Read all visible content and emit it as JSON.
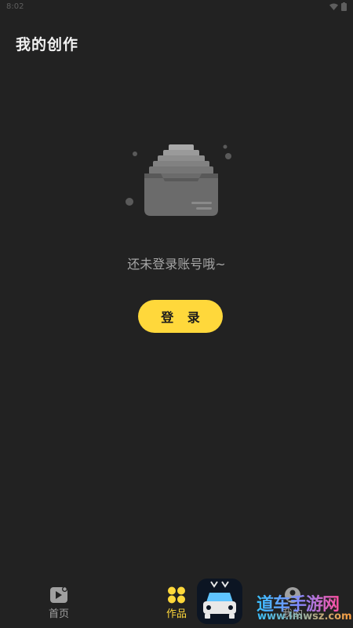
{
  "status_bar": {
    "time": "8:02"
  },
  "header": {
    "title": "我的创作"
  },
  "empty_state": {
    "icon": "empty-inbox-icon",
    "message": "还未登录账号哦~",
    "login_label": "登 录"
  },
  "bottom_nav": {
    "items": [
      {
        "label": "首页",
        "icon": "home-play-icon",
        "active": false
      },
      {
        "label": "作品",
        "icon": "grid-dots-icon",
        "active": true
      },
      {
        "label": "我的",
        "icon": "profile-icon",
        "active": false
      }
    ]
  },
  "watermark": {
    "title": "道车手游网",
    "url": "www.lmwsz.com",
    "icon": "car-app-icon"
  },
  "colors": {
    "background": "#222222",
    "accent": "#ffd83b",
    "muted_text": "#a6a6a6"
  }
}
